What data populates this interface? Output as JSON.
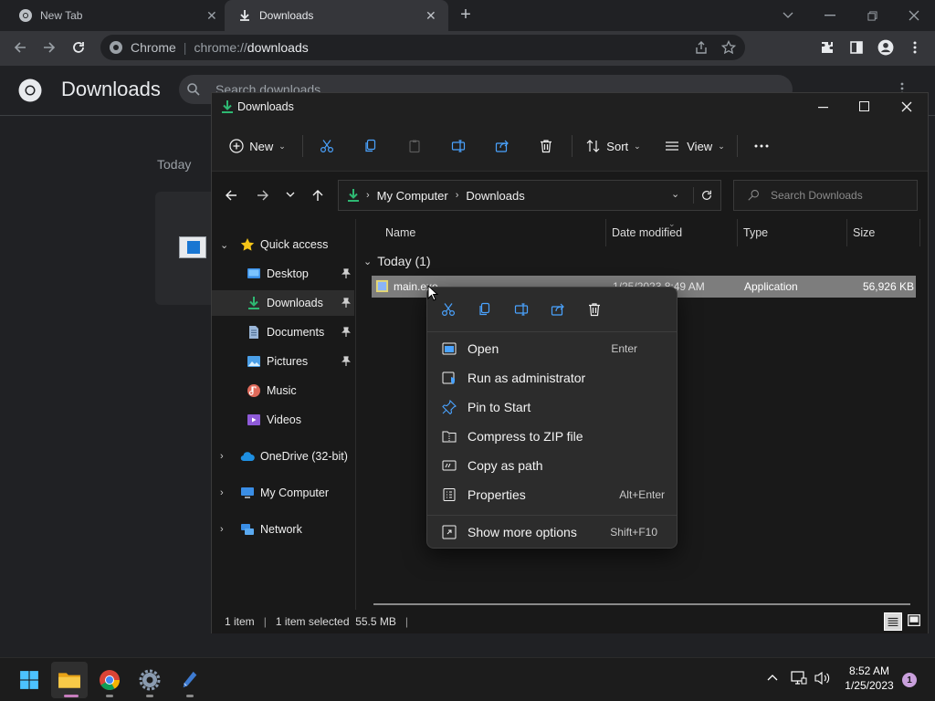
{
  "browser": {
    "tabs": [
      {
        "title": "New Tab"
      },
      {
        "title": "Downloads"
      }
    ],
    "address": {
      "site_label": "Chrome",
      "url_scheme": "chrome://",
      "url_path": "downloads"
    },
    "page": {
      "title": "Downloads",
      "search_placeholder": "Search downloads",
      "section_label": "Today"
    }
  },
  "explorer": {
    "title": "Downloads",
    "toolbar": {
      "new_label": "New",
      "sort_label": "Sort",
      "view_label": "View"
    },
    "breadcrumb": [
      "My Computer",
      "Downloads"
    ],
    "search_placeholder": "Search Downloads",
    "nav": {
      "quick_access": "Quick access",
      "items": [
        {
          "label": "Desktop",
          "pinned": true
        },
        {
          "label": "Downloads",
          "pinned": true,
          "selected": true
        },
        {
          "label": "Documents",
          "pinned": true
        },
        {
          "label": "Pictures",
          "pinned": true
        },
        {
          "label": "Music",
          "pinned": false
        },
        {
          "label": "Videos",
          "pinned": false
        }
      ],
      "roots": [
        "OneDrive (32-bit)",
        "My Computer",
        "Network"
      ]
    },
    "columns": [
      "Name",
      "Date modified",
      "Type",
      "Size"
    ],
    "group_header": "Today (1)",
    "files": [
      {
        "name": "main.exe",
        "date_modified": "1/25/2023 8:49 AM",
        "type": "Application",
        "size": "56,926 KB"
      }
    ],
    "status": {
      "count": "1 item",
      "selection": "1 item selected  55.5 MB"
    }
  },
  "context_menu": {
    "quick_actions": [
      "cut",
      "copy",
      "rename",
      "share",
      "delete"
    ],
    "items": [
      {
        "label": "Open",
        "shortcut": "Enter"
      },
      {
        "label": "Run as administrator",
        "shortcut": ""
      },
      {
        "label": "Pin to Start",
        "shortcut": ""
      },
      {
        "label": "Compress to ZIP file",
        "shortcut": ""
      },
      {
        "label": "Copy as path",
        "shortcut": ""
      },
      {
        "label": "Properties",
        "shortcut": "Alt+Enter"
      }
    ],
    "more": {
      "label": "Show more options",
      "shortcut": "Shift+F10"
    }
  },
  "taskbar": {
    "apps": [
      "Start",
      "File Explorer",
      "Google Chrome",
      "Settings",
      "Pen app"
    ],
    "time": "8:52 AM",
    "date": "1/25/2023",
    "notification_count": "1"
  },
  "colors": {
    "accent": "#0f9d58",
    "selection": "#7d7d7d",
    "notify": "#c9a0dc"
  }
}
